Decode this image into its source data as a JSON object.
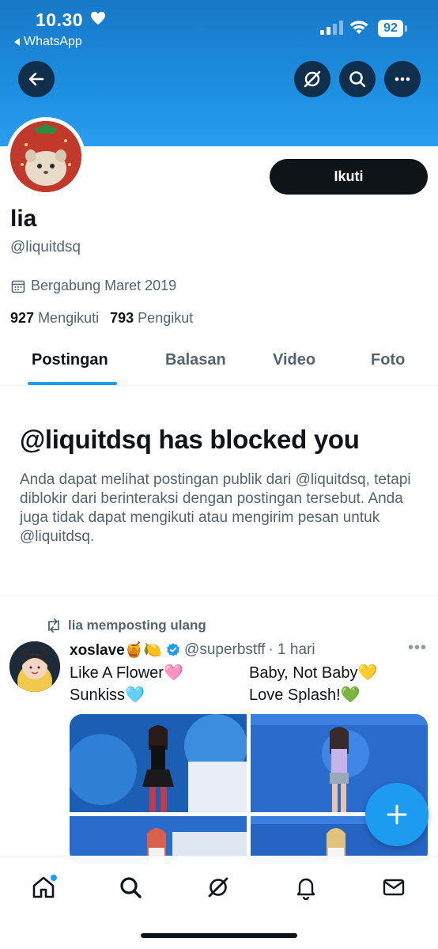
{
  "status_bar": {
    "time": "10.30",
    "back_app": "WhatsApp",
    "battery": "92"
  },
  "profile": {
    "name": "lia",
    "handle": "@liquitdsq",
    "joined": "Bergabung Maret 2019",
    "following_count": "927",
    "following_label": "Mengikuti",
    "followers_count": "793",
    "followers_label": "Pengikut",
    "follow_button": "Ikuti"
  },
  "tabs": [
    {
      "label": "Postingan",
      "active": true
    },
    {
      "label": "Balasan",
      "active": false
    },
    {
      "label": "Video",
      "active": false
    },
    {
      "label": "Foto",
      "active": false
    }
  ],
  "blocked": {
    "title": "@liquitdsq has blocked you",
    "description": "Anda dapat melihat postingan publik dari @liquitdsq, tetapi diblokir dari berinteraksi dengan postingan tersebut. Anda juga tidak dapat mengikuti atau mengirim pesan untuk @liquitdsq."
  },
  "post": {
    "repost_label": "lia memposting ulang",
    "author_name": "xoslave🍯🍋",
    "author_handle": "@superbstff",
    "time": "· 1 hari",
    "lines_left": [
      "Like A Flower🩷",
      "Sunkiss🩵"
    ],
    "lines_right": [
      "Baby, Not Baby💛",
      "Love Splash!💚"
    ]
  },
  "icons": {
    "back": "arrow-left-icon",
    "grok": "grok-icon",
    "search": "search-icon",
    "more": "more-horizontal-icon",
    "calendar": "calendar-icon",
    "repost": "repost-icon",
    "verified": "verified-badge-icon",
    "compose": "plus-icon",
    "nav": [
      "home-icon",
      "search-icon",
      "grok-icon",
      "bell-icon",
      "mail-icon"
    ]
  },
  "colors": {
    "accent": "#1d9bf0",
    "banner": "#1d8fe0",
    "text": "#0f1419",
    "muted": "#536471"
  }
}
